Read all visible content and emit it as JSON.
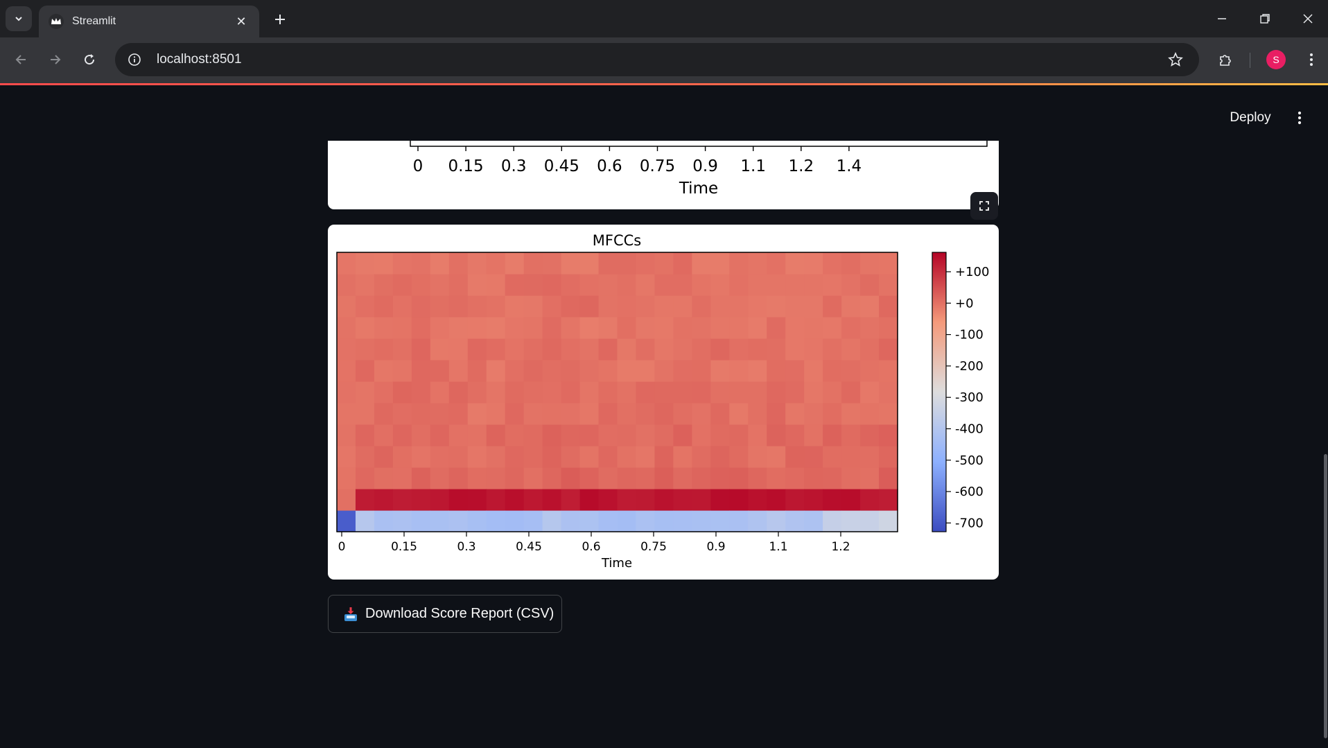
{
  "browser": {
    "tab_title": "Streamlit",
    "url": "localhost:8501",
    "profile_initial": "S"
  },
  "app_header": {
    "deploy_label": "Deploy"
  },
  "download_button": {
    "label": "Download Score Report (CSV)",
    "icon": "inbox-tray-icon"
  },
  "colors": {
    "app_background": "#0e1117",
    "accent": "#ff4b4b",
    "panel": "#ffffff"
  },
  "chart_data": [
    {
      "type": "line",
      "title": "",
      "xlabel": "Time",
      "ylabel": "",
      "x_ticks": [
        "0",
        "0.15",
        "0.3",
        "0.45",
        "0.6",
        "0.75",
        "0.9",
        "1.1",
        "1.2",
        "1.4"
      ],
      "note_visible_part": "only bottom axis of this chart is visible"
    },
    {
      "type": "heatmap",
      "title": "MFCCs",
      "xlabel": "Time",
      "ylabel": "",
      "x_ticks": [
        "0",
        "0.15",
        "0.3",
        "0.45",
        "0.6",
        "0.75",
        "0.9",
        "1.1",
        "1.2"
      ],
      "colorbar": {
        "colormap": "coolwarm",
        "ticks": [
          "+100",
          "+0",
          "-100",
          "-200",
          "-300",
          "-400",
          "-500",
          "-600",
          "-700"
        ],
        "range": [
          -740,
          175
        ]
      },
      "n_frames": 30,
      "n_coefficients": 13,
      "coefficient_levels": [
        {
          "coef": 0,
          "value": -420
        },
        {
          "coef": 1,
          "value": 150
        },
        {
          "coef": 2,
          "value": 25
        },
        {
          "coef": 3,
          "value": 15
        },
        {
          "coef": 4,
          "value": 20
        },
        {
          "coef": 5,
          "value": 10
        },
        {
          "coef": 6,
          "value": 12
        },
        {
          "coef": 7,
          "value": 8
        },
        {
          "coef": 8,
          "value": 12
        },
        {
          "coef": 9,
          "value": 5
        },
        {
          "coef": 10,
          "value": 10
        },
        {
          "coef": 11,
          "value": 8
        },
        {
          "coef": 12,
          "value": 5
        }
      ],
      "first_frame_c0": -700
    }
  ]
}
